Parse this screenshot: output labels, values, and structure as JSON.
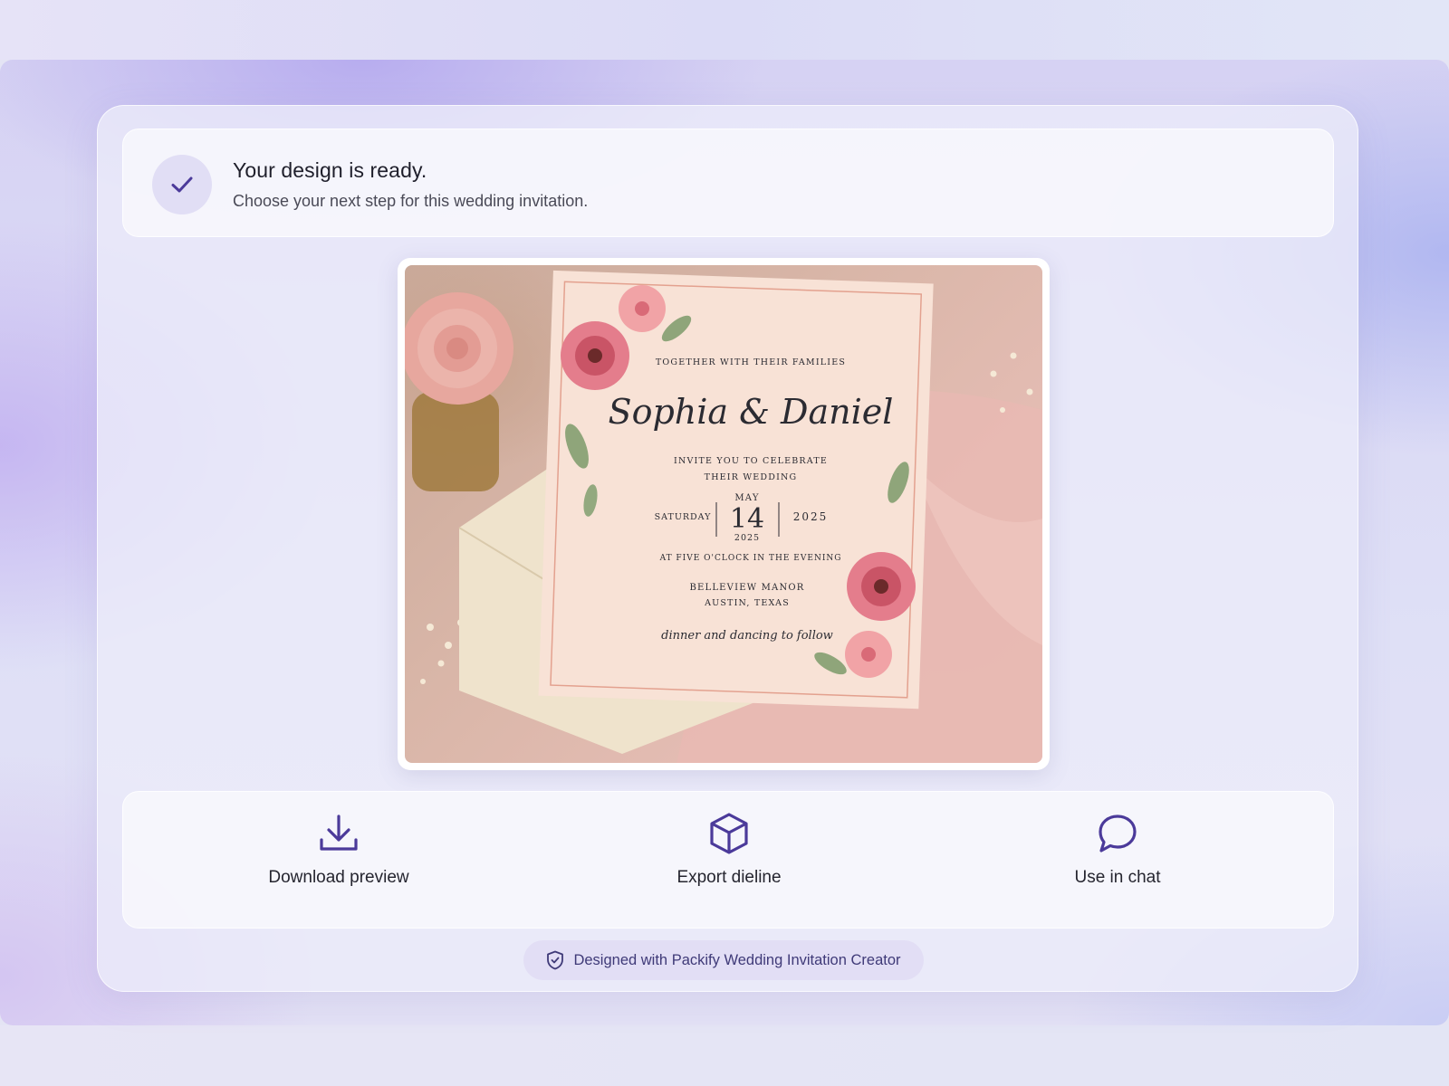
{
  "banner": {
    "title": "Your design is ready.",
    "subtitle": "Choose your next step for this wedding invitation."
  },
  "invitation": {
    "intro": "TOGETHER WITH THEIR FAMILIES",
    "names": "Sophia & Daniel",
    "invite_line1": "INVITE YOU TO CELEBRATE",
    "invite_line2": "THEIR WEDDING",
    "weekday": "SATURDAY",
    "month": "MAY",
    "day": "14",
    "year_small": "2025",
    "year": "2025",
    "time": "AT FIVE O'CLOCK IN THE EVENING",
    "venue": "BELLEVIEW MANOR",
    "city": "AUSTIN, TEXAS",
    "closing": "dinner and dancing to follow"
  },
  "actions": [
    {
      "label": "Download preview",
      "icon": "download-icon"
    },
    {
      "label": "Export dieline",
      "icon": "cube-icon"
    },
    {
      "label": "Use in chat",
      "icon": "chat-bubble-icon"
    }
  ],
  "footer": {
    "text": "Designed with Packify Wedding Invitation Creator",
    "icon": "shield-check-icon"
  },
  "colors": {
    "accent": "#4b3a9a",
    "check_bg": "#e1def5",
    "pill_bg": "#e2def5"
  }
}
